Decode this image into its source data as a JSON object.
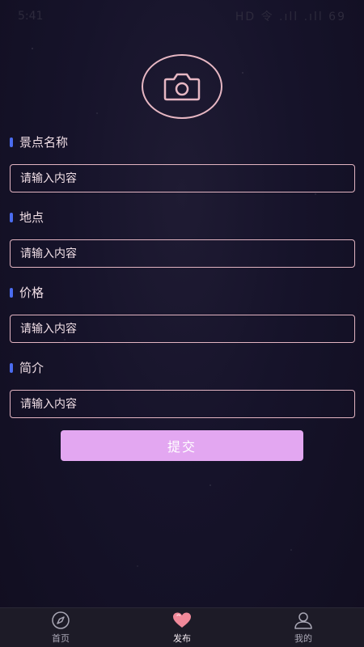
{
  "status_bar": {
    "time": "5:41",
    "indicators": "HD 令 .ıll .ıll 69"
  },
  "upload": {
    "icon": "camera-icon"
  },
  "form": {
    "fields": [
      {
        "label": "景点名称",
        "placeholder": "请输入内容"
      },
      {
        "label": "地点",
        "placeholder": "请输入内容"
      },
      {
        "label": "价格",
        "placeholder": "请输入内容"
      },
      {
        "label": "简介",
        "placeholder": "请输入内容"
      }
    ],
    "submit_label": "提交"
  },
  "tabbar": {
    "tabs": [
      {
        "label": "首页",
        "icon": "compass-icon"
      },
      {
        "label": "发布",
        "icon": "heart-icon",
        "active": true
      },
      {
        "label": "我的",
        "icon": "user-icon"
      }
    ]
  },
  "colors": {
    "accent_border": "#e2b4c1",
    "label_bar": "#4b6cf0",
    "submit_bg": "#e3a7f1"
  }
}
